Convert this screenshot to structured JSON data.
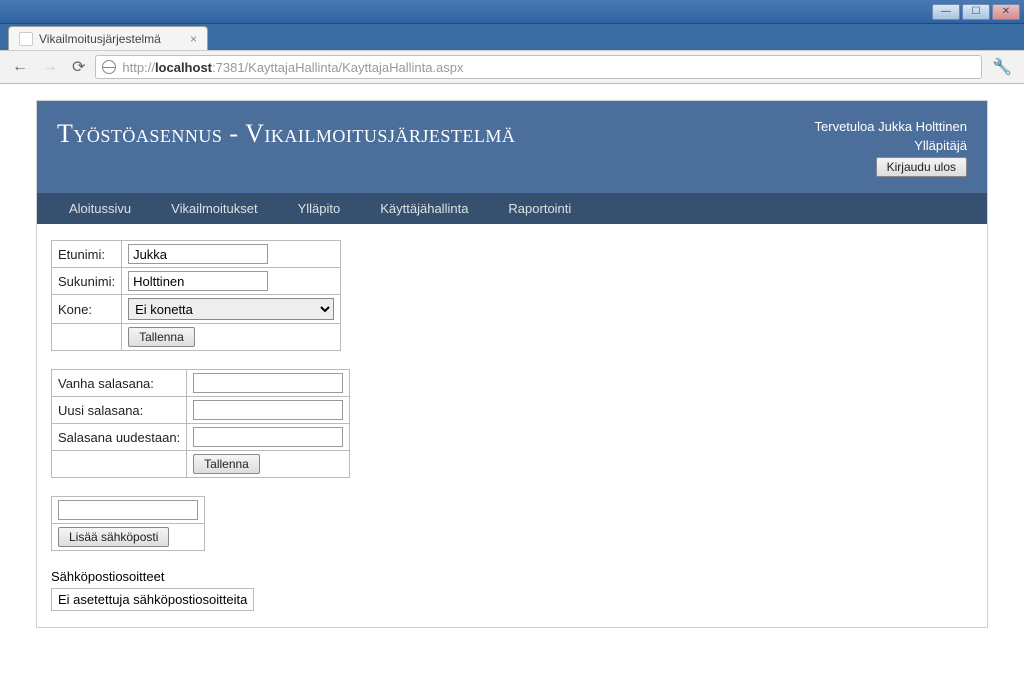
{
  "window": {
    "tab_title": "Vikailmoitusjärjestelmä",
    "url_prefix": "http://",
    "url_host": "localhost",
    "url_path": ":7381/KayttajaHallinta/KayttajaHallinta.aspx"
  },
  "banner": {
    "title": "Työstöasennus - Vikailmoitusjärjestelmä",
    "welcome": "Tervetuloa Jukka Holttinen",
    "role": "Ylläpitäjä",
    "logout": "Kirjaudu ulos"
  },
  "nav": {
    "items": [
      {
        "label": "Aloitussivu"
      },
      {
        "label": "Vikailmoitukset"
      },
      {
        "label": "Ylläpito"
      },
      {
        "label": "Käyttäjähallinta"
      },
      {
        "label": "Raportointi"
      }
    ]
  },
  "profile": {
    "firstname_label": "Etunimi:",
    "firstname_value": "Jukka",
    "lastname_label": "Sukunimi:",
    "lastname_value": "Holttinen",
    "machine_label": "Kone:",
    "machine_value": "Ei konetta",
    "save": "Tallenna"
  },
  "password": {
    "old_label": "Vanha salasana:",
    "new_label": "Uusi salasana:",
    "repeat_label": "Salasana uudestaan:",
    "save": "Tallenna"
  },
  "email": {
    "add_button": "Lisää sähköposti",
    "list_heading": "Sähköpostiosoitteet",
    "empty": "Ei asetettuja sähköpostiosoitteita"
  }
}
